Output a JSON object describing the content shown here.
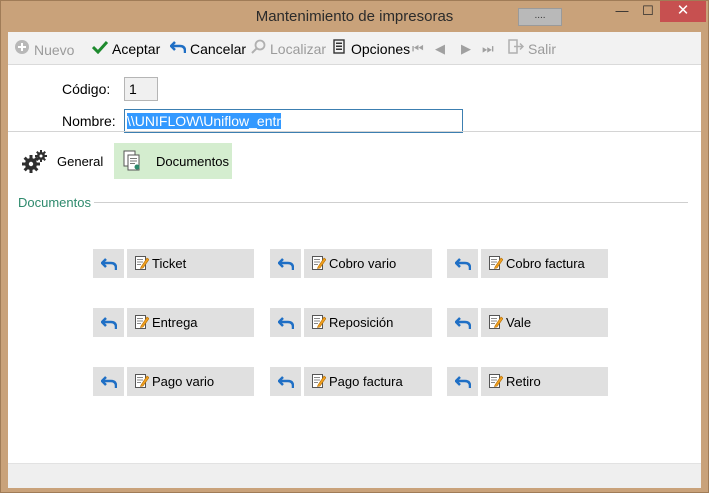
{
  "window": {
    "title": "Mantenimiento de impresoras",
    "dots_label": "....",
    "minimize_glyph": "—",
    "maximize_glyph": "☐",
    "close_glyph": "✕"
  },
  "toolbar": {
    "nuevo": "Nuevo",
    "aceptar": "Aceptar",
    "cancelar": "Cancelar",
    "localizar": "Localizar",
    "opciones": "Opciones",
    "salir": "Salir",
    "nav_first": "⏮",
    "nav_prev": "◀",
    "nav_next": "▶",
    "nav_last": "⏭"
  },
  "form": {
    "codigo_label": "Código:",
    "codigo_value": "1",
    "nombre_label": "Nombre:",
    "nombre_value": "\\\\UNIFLOW\\Uniflow_entr"
  },
  "tabs": {
    "general": "General",
    "documentos": "Documentos"
  },
  "section": {
    "title": "Documentos"
  },
  "documents": [
    {
      "label": "Ticket"
    },
    {
      "label": "Cobro vario"
    },
    {
      "label": "Cobro factura"
    },
    {
      "label": "Entrega"
    },
    {
      "label": "Reposición"
    },
    {
      "label": "Vale"
    },
    {
      "label": "Pago vario"
    },
    {
      "label": "Pago factura"
    },
    {
      "label": "Retiro"
    }
  ],
  "colors": {
    "titlebar": "#c9a27a",
    "accent_blue": "#1f6fc5",
    "active_tab": "#d4edcf",
    "section_text": "#2e8a6d",
    "close_button": "#c75050"
  }
}
